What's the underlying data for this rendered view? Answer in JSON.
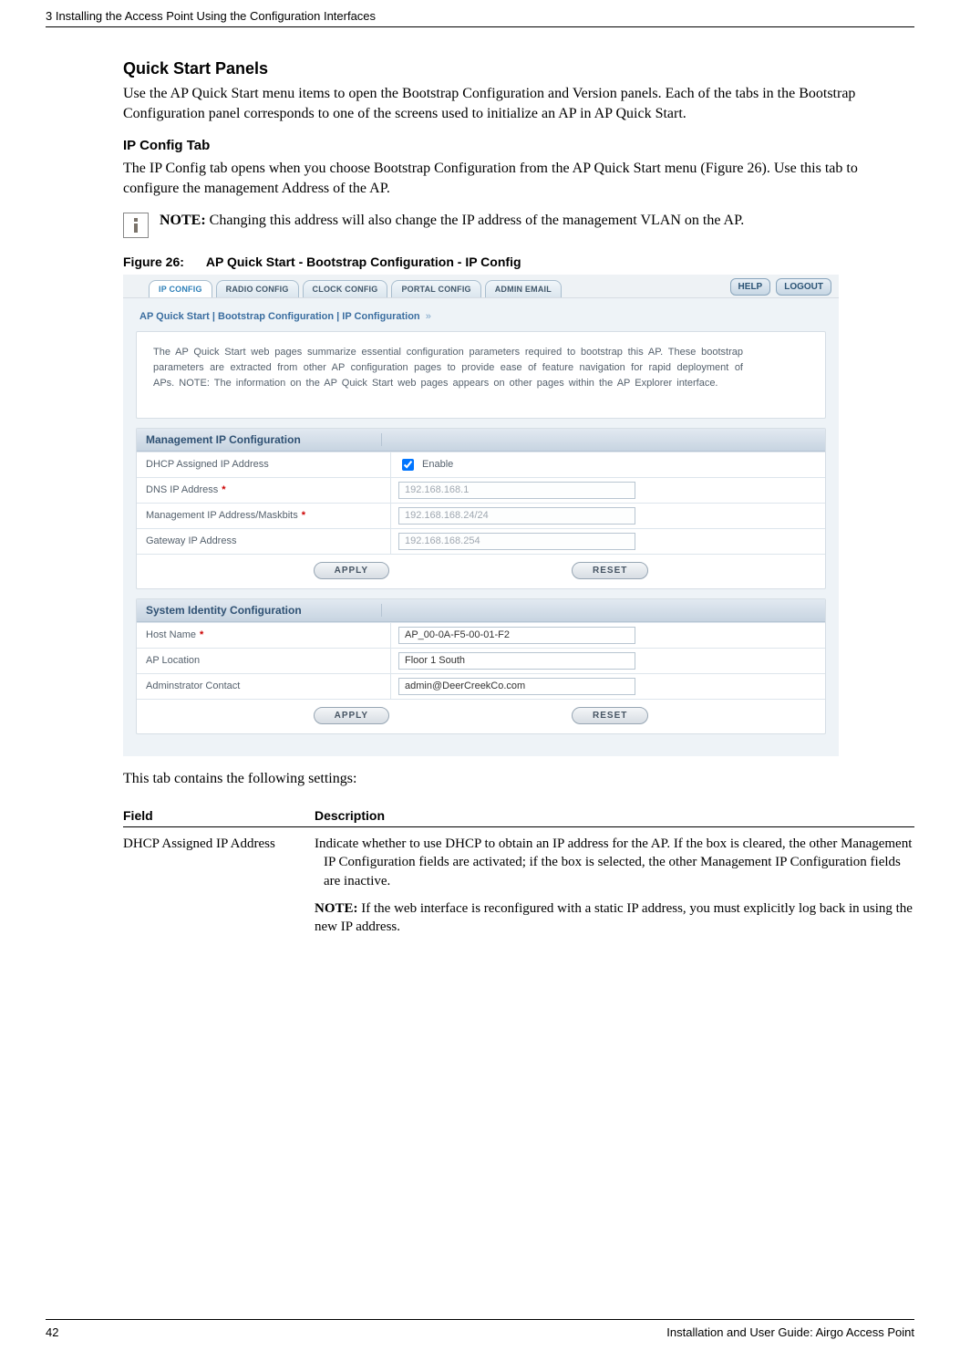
{
  "header": {
    "left": "3  Installing the Access Point Using the Configuration Interfaces"
  },
  "section": {
    "title": "Quick Start Panels",
    "intro": "Use the AP Quick Start menu items to open the Bootstrap Configuration and Version panels. Each of the tabs in the Bootstrap Configuration panel corresponds to one of the screens used to initialize an AP in AP Quick Start."
  },
  "subsection": {
    "title": "IP Config Tab",
    "body": "The IP Config tab opens when you choose Bootstrap Configuration from the AP Quick Start menu (Figure 26). Use this tab to configure the management Address of the AP."
  },
  "note": {
    "label": "NOTE:",
    "text": " Changing this address will also change the IP address of the management VLAN on the AP."
  },
  "figure": {
    "num": "Figure 26:",
    "title": "AP Quick Start - Bootstrap Configuration - IP Config"
  },
  "screenshot": {
    "tabs": [
      "IP CONFIG",
      "RADIO CONFIG",
      "CLOCK CONFIG",
      "PORTAL CONFIG",
      "ADMIN EMAIL"
    ],
    "help": "HELP",
    "logout": "LOGOUT",
    "breadcrumb": "AP Quick Start | Bootstrap Configuration | IP Configuration",
    "bc_arrows": "»",
    "introText": "The AP Quick Start web pages summarize essential configuration parameters required to bootstrap this AP. These bootstrap parameters are extracted from other AP configuration pages to provide ease of feature navigation for rapid deployment of APs.        NOTE: The information on the AP Quick Start web pages appears on other pages within the AP Explorer interface.",
    "mip": {
      "header": "Management IP Configuration",
      "rows": {
        "dhcp_label": "DHCP Assigned IP Address",
        "dhcp_enable": "Enable",
        "dns_label": "DNS IP Address",
        "dns_value": "192.168.168.1",
        "mgmt_label": "Management IP Address/Maskbits",
        "mgmt_value": "192.168.168.24/24",
        "gw_label": "Gateway IP Address",
        "gw_value": "192.168.168.254"
      }
    },
    "sys": {
      "header": "System Identity Configuration",
      "rows": {
        "host_label": "Host Name",
        "host_value": "AP_00-0A-F5-00-01-F2",
        "loc_label": "AP Location",
        "loc_value": "Floor 1 South",
        "admin_label": "Adminstrator Contact",
        "admin_value": "admin@DeerCreekCo.com"
      }
    },
    "apply": "APPLY",
    "reset": "RESET"
  },
  "afterFig": "This tab contains the following settings:",
  "table": {
    "h1": "Field",
    "h2": "Description",
    "r1c1": "DHCP Assigned IP Address",
    "r1c2a": "Indicate whether to use DHCP to obtain an IP address for the AP. If the box is cleared, the other Management IP Configuration fields are activated; if the box is selected, the other Management IP Configuration fields are inactive.",
    "r1c2b_label": "NOTE:",
    "r1c2b": " If the web interface is reconfigured with a static IP address, you must explicitly log back in using the new IP address."
  },
  "footer": {
    "page": "42",
    "right": "Installation and User Guide: Airgo Access Point"
  }
}
